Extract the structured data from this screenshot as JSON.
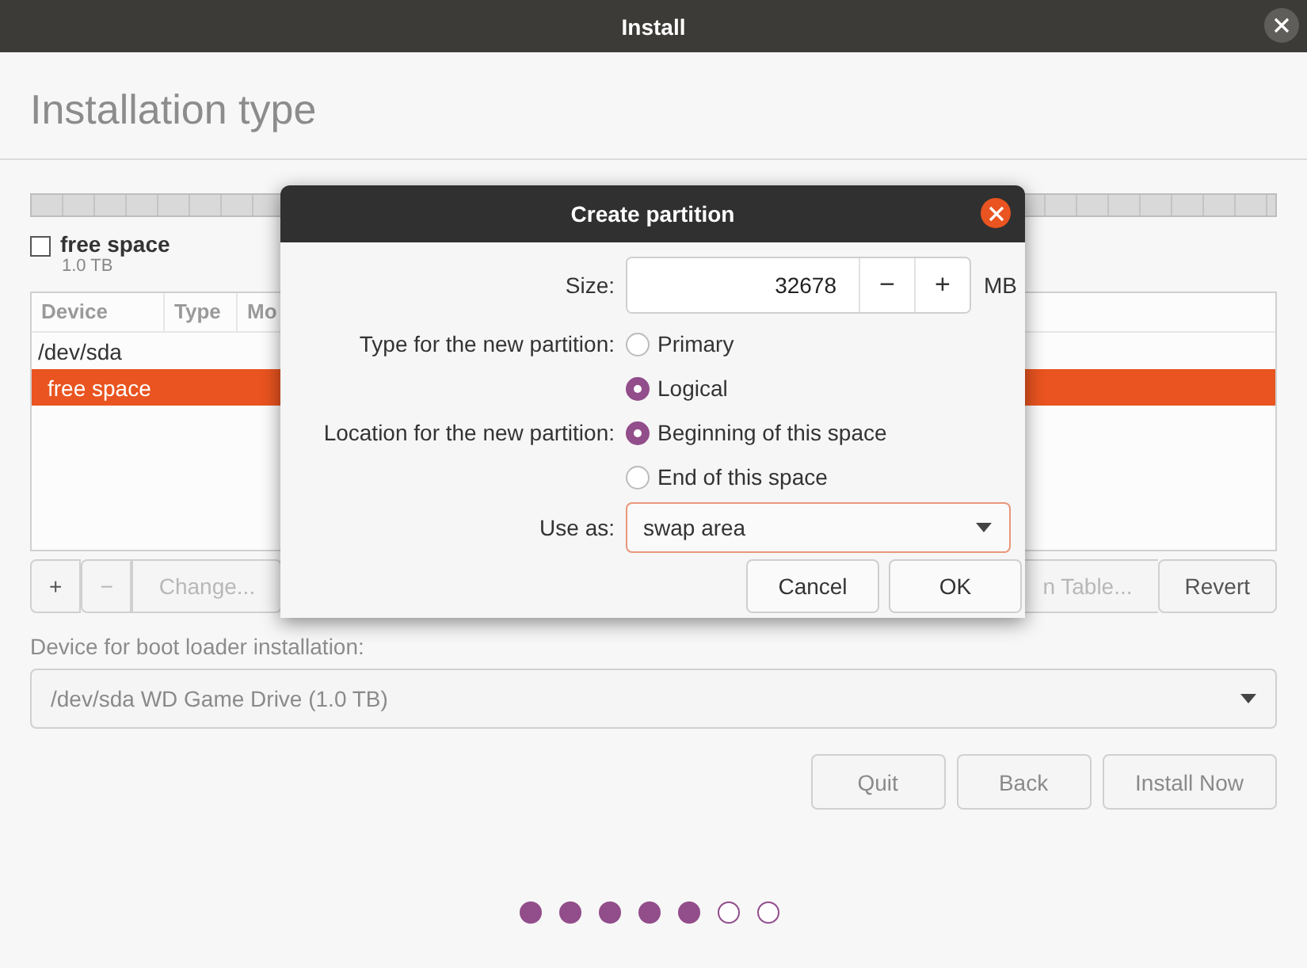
{
  "window": {
    "title": "Install"
  },
  "heading": "Installation type",
  "legend": [
    {
      "label": "free space",
      "size": "1.0 TB",
      "checked": false
    }
  ],
  "table": {
    "columns": [
      "Device",
      "Type",
      "Mo"
    ],
    "rows": [
      {
        "device": "/dev/sda",
        "selected": false
      },
      {
        "device": "free space",
        "selected": true
      }
    ]
  },
  "partition_buttons": [
    {
      "label": "+",
      "disabled": false
    },
    {
      "label": "−",
      "disabled": true
    },
    {
      "label": "Change...",
      "disabled": true
    },
    {
      "label": "n Table...",
      "disabled": true
    },
    {
      "label": "Revert",
      "disabled": false
    }
  ],
  "boot_loader": {
    "label": "Device for boot loader installation:",
    "value": "/dev/sda WD Game Drive (1.0 TB)"
  },
  "nav_buttons": [
    "Quit",
    "Back",
    "Install Now"
  ],
  "progress_dots": [
    {
      "filled": true
    },
    {
      "filled": true
    },
    {
      "filled": true
    },
    {
      "filled": true
    },
    {
      "filled": true
    },
    {
      "filled": false
    },
    {
      "filled": false
    }
  ],
  "dialog": {
    "title": "Create partition",
    "size": {
      "label": "Size:",
      "value": "32678",
      "decrement": "−",
      "increment": "+",
      "unit": "MB"
    },
    "groups": [
      {
        "label": "Type for the new partition:",
        "options": [
          {
            "label": "Primary",
            "selected": false
          },
          {
            "label": "Logical",
            "selected": true
          }
        ]
      },
      {
        "label": "Location for the new partition:",
        "options": [
          {
            "label": "Beginning of this space",
            "selected": true
          },
          {
            "label": "End of this space",
            "selected": false
          }
        ]
      }
    ],
    "use_as": {
      "label": "Use as:",
      "value": "swap area"
    },
    "buttons": [
      "Cancel",
      "OK"
    ]
  }
}
